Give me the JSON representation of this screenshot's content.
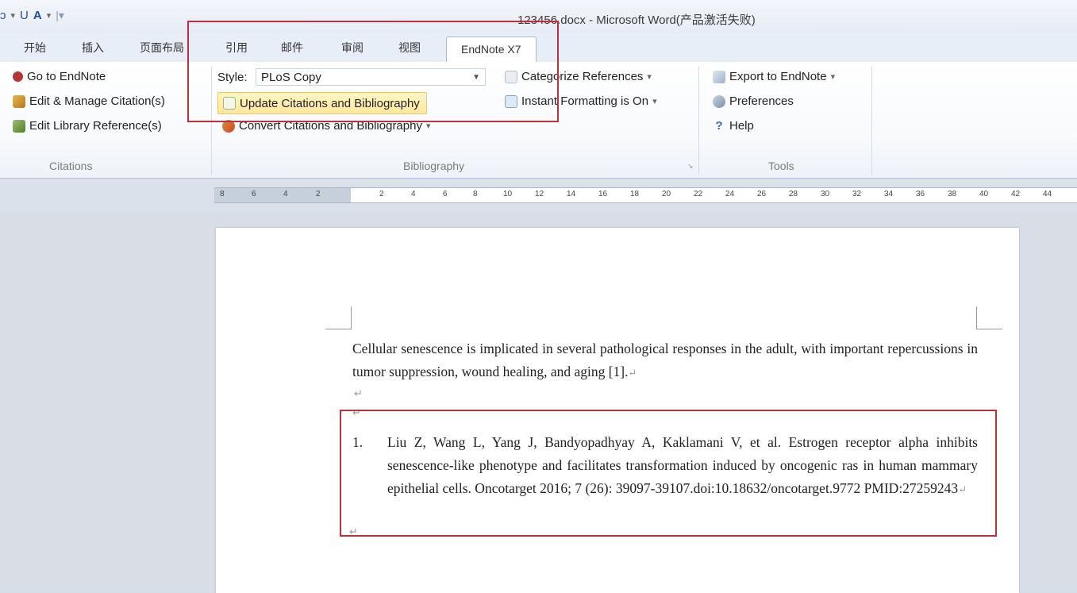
{
  "window": {
    "title": "123456.docx - Microsoft Word(产品激活失败)"
  },
  "qat": {
    "undo_glyph": "ↄ",
    "redo_glyph": "U",
    "font_color_glyph": "A",
    "dropdown_glyph": "▾",
    "customize_glyph": "|▾"
  },
  "tabs": [
    {
      "label": "开始"
    },
    {
      "label": "插入"
    },
    {
      "label": "页面布局"
    },
    {
      "label": "引用"
    },
    {
      "label": "邮件"
    },
    {
      "label": "审阅"
    },
    {
      "label": "视图"
    },
    {
      "label": "EndNote X7",
      "active": true
    }
  ],
  "ribbon": {
    "citations": {
      "label": "Citations",
      "go_to_endnote": "Go to EndNote",
      "edit_manage": "Edit & Manage Citation(s)",
      "edit_library": "Edit Library Reference(s)"
    },
    "bibliography": {
      "label": "Bibliography",
      "style_label": "Style:",
      "style_value": "PLoS Copy",
      "update": "Update Citations and Bibliography",
      "convert": "Convert Citations and Bibliography",
      "categorize": "Categorize References",
      "instant": "Instant Formatting is On"
    },
    "tools": {
      "label": "Tools",
      "export": "Export to EndNote",
      "preferences": "Preferences",
      "help": "Help"
    }
  },
  "ruler": {
    "numbers": [
      "8",
      "6",
      "4",
      "2",
      "2",
      "4",
      "6",
      "8",
      "10",
      "12",
      "14",
      "16",
      "18",
      "20",
      "22",
      "24",
      "26",
      "28",
      "30",
      "32",
      "34",
      "36",
      "38",
      "40",
      "42",
      "44"
    ]
  },
  "document": {
    "paragraph": "Cellular senescence is implicated in several pathological responses in the adult, with important repercussions in tumor suppression, wound healing, and aging [1].",
    "reference_number": "1.",
    "reference_text": "Liu Z, Wang L, Yang J, Bandyopadhyay A, Kaklamani V, et al. Estrogen receptor alpha inhibits senescence-like phenotype and facilitates transformation induced by oncogenic ras in human mammary epithelial cells. Oncotarget 2016; 7 (26): 39097-39107.doi:10.18632/oncotarget.9772 PMID:27259243",
    "paragraph_mark": "↵"
  },
  "colors": {
    "highlight_box": "#c0303b",
    "update_button_bg": "#ffe79a"
  }
}
